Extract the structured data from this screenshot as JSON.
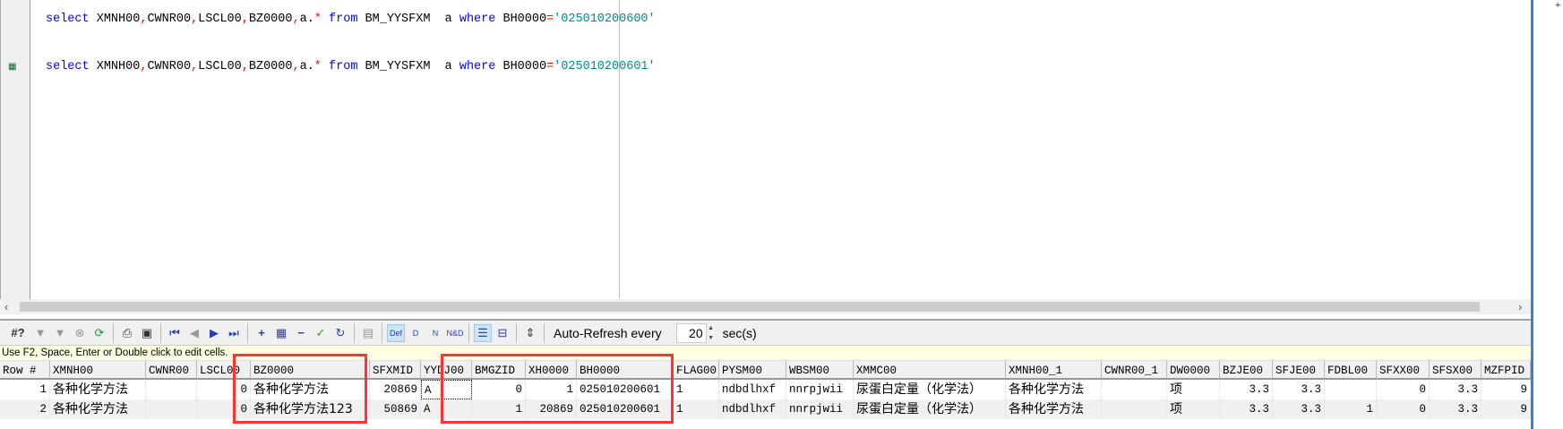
{
  "editor": {
    "lines": [
      {
        "select": "select",
        "cols": [
          "XMNH00",
          "CWNR00",
          "LSCL00",
          "BZ0000",
          "a."
        ],
        "star": "*",
        "from": "from",
        "table": "BM_YYSFXM  a",
        "where": "where",
        "field": "BH0000",
        "eq": "=",
        "value": "'025010200600'"
      },
      {
        "select": "select",
        "cols": [
          "XMNH00",
          "CWNR00",
          "LSCL00",
          "BZ0000",
          "a."
        ],
        "star": "*",
        "from": "from",
        "table": "BM_YYSFXM  a",
        "where": "where",
        "field": "BH0000",
        "eq": "=",
        "value": "'025010200601'"
      }
    ],
    "comma": ",",
    "top_right_glyph": "+"
  },
  "toolbar": {
    "query_label": "#?",
    "auto_refresh_label": "Auto-Refresh every",
    "auto_refresh_value": "20",
    "auto_refresh_unit": "sec(s)",
    "def_label": "Def",
    "d_label": "D",
    "n_label": "N",
    "nd_label": "N&D"
  },
  "hint": "Use F2, Space, Enter or Double click to edit cells.",
  "grid": {
    "columns": [
      "Row #",
      "XMNH00",
      "CWNR00",
      "LSCL00",
      "BZ0000",
      "SFXMID",
      "YYDJ00",
      "BMGZID",
      "XH0000",
      "BH0000",
      "FLAG00",
      "PYSM00",
      "WBSM00",
      "XMMC00",
      "XMNH00_1",
      "CWNR00_1",
      "DW0000",
      "BZJE00",
      "SFJE00",
      "FDBL00",
      "SFXX00",
      "SFSX00",
      "MZFPID"
    ],
    "rows": [
      [
        "1",
        "各种化学方法",
        "",
        "0",
        "各种化学方法",
        "20869",
        "A",
        "0",
        "1",
        "025010200601",
        "1",
        "ndbdlhxf",
        "nnrpjwii",
        "尿蛋白定量（化学法）",
        "各种化学方法",
        "",
        "项",
        "3.3",
        "3.3",
        "",
        "0",
        "3.3",
        "9"
      ],
      [
        "2",
        "各种化学方法",
        "",
        "0",
        "各种化学方法123",
        "50869",
        "A",
        "1",
        "20869",
        "025010200601",
        "1",
        "ndbdlhxf",
        "nnrpjwii",
        "尿蛋白定量（化学法）",
        "各种化学方法",
        "",
        "项",
        "3.3",
        "3.3",
        "1",
        "0",
        "3.3",
        "9"
      ]
    ]
  },
  "colors": {
    "keyword": "#0000ff",
    "punct": "#ff0000",
    "string": "#008c8c",
    "highlight_box": "#ff3333"
  }
}
